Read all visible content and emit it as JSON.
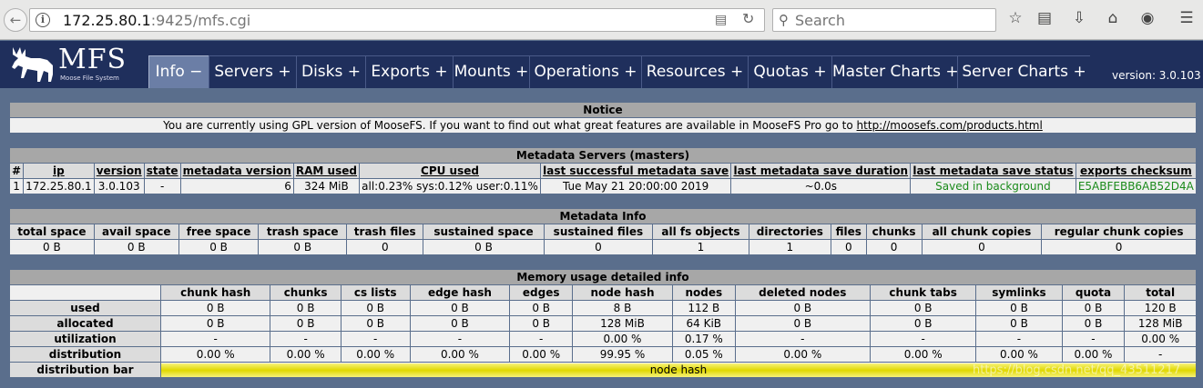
{
  "browser": {
    "url_host": "172.25.80.1",
    "url_rest": ":9425/mfs.cgi",
    "search_placeholder": "Search"
  },
  "header": {
    "logo_text": "MFS",
    "logo_sub": "Moose File System",
    "version": "version: 3.0.103",
    "menu": [
      {
        "label": "Info −",
        "active": true
      },
      {
        "label": "Servers +",
        "active": false
      },
      {
        "label": "Disks +",
        "active": false
      },
      {
        "label": "Exports +",
        "active": false
      },
      {
        "label": "Mounts +",
        "active": false
      },
      {
        "label": "Operations +",
        "active": false
      },
      {
        "label": "Resources +",
        "active": false
      },
      {
        "label": "Quotas +",
        "active": false
      },
      {
        "label": "Master Charts +",
        "active": false
      },
      {
        "label": "Server Charts +",
        "active": false
      }
    ]
  },
  "notice": {
    "title": "Notice",
    "text": "You are currently using GPL version of MooseFS. If you want to find out what great features are available in MooseFS Pro go to ",
    "link": "http://moosefs.com/products.html"
  },
  "masters": {
    "title": "Metadata Servers (masters)",
    "columns": [
      "#",
      "ip",
      "version",
      "state",
      "metadata version",
      "RAM used",
      "CPU used",
      "last successful metadata save",
      "last metadata save duration",
      "last metadata save status",
      "exports checksum"
    ],
    "row": [
      "1",
      "172.25.80.1",
      "3.0.103",
      "-",
      "6",
      "324 MiB",
      "all:0.23% sys:0.12% user:0.11%",
      "Tue May 21 20:00:00 2019",
      "~0.0s",
      "Saved in background",
      "E5ABFEBB6AB52D4A"
    ]
  },
  "metainfo": {
    "title": "Metadata Info",
    "columns": [
      "total space",
      "avail space",
      "free space",
      "trash space",
      "trash files",
      "sustained space",
      "sustained files",
      "all fs objects",
      "directories",
      "files",
      "chunks",
      "all chunk copies",
      "regular chunk copies"
    ],
    "row": [
      "0 B",
      "0 B",
      "0 B",
      "0 B",
      "0",
      "0 B",
      "0",
      "1",
      "1",
      "0",
      "0",
      "0",
      "0"
    ]
  },
  "memory": {
    "title": "Memory usage detailed info",
    "columns": [
      "chunk hash",
      "chunks",
      "cs lists",
      "edge hash",
      "edges",
      "node hash",
      "nodes",
      "deleted nodes",
      "chunk tabs",
      "symlinks",
      "quota",
      "total"
    ],
    "rows": [
      {
        "label": "used",
        "values": [
          "0 B",
          "0 B",
          "0 B",
          "0 B",
          "0 B",
          "8 B",
          "112 B",
          "0 B",
          "0 B",
          "0 B",
          "0 B",
          "120 B"
        ]
      },
      {
        "label": "allocated",
        "values": [
          "0 B",
          "0 B",
          "0 B",
          "0 B",
          "0 B",
          "128 MiB",
          "64 KiB",
          "0 B",
          "0 B",
          "0 B",
          "0 B",
          "128 MiB"
        ]
      },
      {
        "label": "utilization",
        "values": [
          "-",
          "-",
          "-",
          "-",
          "-",
          "0.00 %",
          "0.17 %",
          "-",
          "-",
          "-",
          "-",
          "0.00 %"
        ]
      },
      {
        "label": "distribution",
        "values": [
          "0.00 %",
          "0.00 %",
          "0.00 %",
          "0.00 %",
          "0.00 %",
          "99.95 %",
          "0.05 %",
          "0.00 %",
          "0.00 %",
          "0.00 %",
          "0.00 %",
          "-"
        ]
      }
    ],
    "bar_label": "distribution bar",
    "bar_text": "node hash"
  },
  "watermark": "https://blog.csdn.net/qq_43511217"
}
